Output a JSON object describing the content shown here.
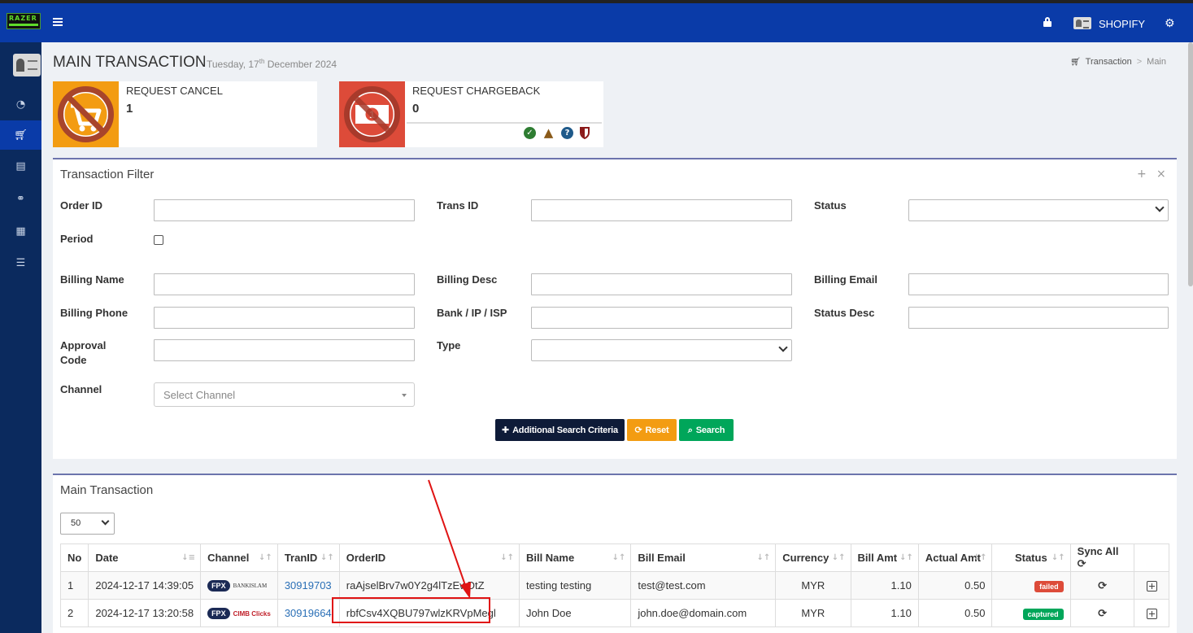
{
  "topbar": {
    "logo_text": "RAZER",
    "user_name": "SHOPIFY"
  },
  "colors": {
    "topbar": "#0a3ba8",
    "sidebar": "#0b2a5e",
    "cancel": "#f39c12",
    "chargeback": "#dd4b39",
    "failed": "#dd4b39",
    "captured": "#00a65a",
    "annotation": "#e01414"
  },
  "sidebar": {
    "items": [
      "dashboard-icon",
      "cart-icon",
      "building-icon",
      "link-icon",
      "document-icon",
      "list-icon"
    ]
  },
  "page": {
    "title": "MAIN TRANSACTION",
    "date_prefix": "Tuesday, 17",
    "date_suffix": "th",
    "date_rest": " December 2024"
  },
  "breadcrumb": {
    "parent": "Transaction",
    "separator": ">",
    "current": "Main"
  },
  "stats": {
    "cancel": {
      "label": "REQUEST CANCEL",
      "value": "1"
    },
    "chargeback": {
      "label": "REQUEST CHARGEBACK",
      "value": "0",
      "note_icon": "1"
    }
  },
  "filter": {
    "title": "Transaction Filter",
    "labels": {
      "order_id": "Order ID",
      "trans_id": "Trans ID",
      "status": "Status",
      "period": "Period",
      "billing_name": "Billing Name",
      "billing_desc": "Billing Desc",
      "billing_email": "Billing Email",
      "billing_phone": "Billing Phone",
      "bank": "Bank / IP / ISP",
      "status_desc": "Status Desc",
      "approval_1": "Approval",
      "approval_2": "Code",
      "type": "Type",
      "channel": "Channel"
    },
    "channel_placeholder": "Select Channel",
    "buttons": {
      "additional": "Additional Search Criteria",
      "reset": "Reset",
      "search": "Search"
    }
  },
  "main": {
    "title": "Main Transaction",
    "page_length": "50",
    "columns": [
      "No",
      "Date",
      "Channel",
      "TranID",
      "OrderID",
      "Bill Name",
      "Bill Email",
      "Currency",
      "Bill Amt",
      "Actual Amt",
      "Status",
      "Sync All"
    ],
    "rows": [
      {
        "no": "1",
        "date": "2024-12-17 14:39:05",
        "ch_logo": "FPX",
        "ch_bank": "BANKISLAM",
        "tranid": "30919703",
        "orderid": "raAjselBrv7w0Y2g4lTzEwDtZ",
        "bill_name": "testing testing",
        "bill_email": "test@test.com",
        "currency": "MYR",
        "bill_amt": "1.10",
        "actual_amt": "0.50",
        "status": "failed"
      },
      {
        "no": "2",
        "date": "2024-12-17 13:20:58",
        "ch_logo": "FPX",
        "ch_bank": "CIMB Clicks",
        "tranid": "30919664",
        "orderid": "rbfCsv4XQBU797wlzKRVpMegl",
        "bill_name": "John Doe",
        "bill_email": "john.doe@domain.com",
        "currency": "MYR",
        "bill_amt": "1.10",
        "actual_amt": "0.50",
        "status": "captured"
      }
    ]
  }
}
